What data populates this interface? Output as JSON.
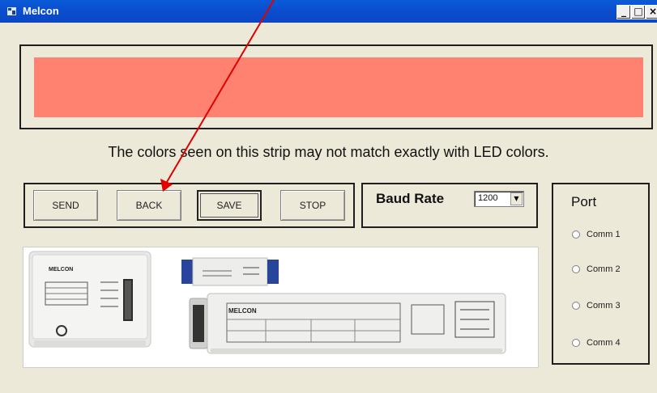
{
  "window": {
    "title": "Melcon",
    "minimize_glyph": "_",
    "maximize_glyph": "□",
    "close_glyph": "×"
  },
  "color_strip": {
    "color": "#ff8270"
  },
  "caption": "The colors seen on this strip may not match exactly with LED colors.",
  "buttons": {
    "send": "SEND",
    "back": "BACK",
    "save": "SAVE",
    "stop": "STOP"
  },
  "baud": {
    "label": "Baud Rate",
    "value": "1200",
    "arrow": "▼"
  },
  "port": {
    "title": "Port",
    "options": [
      "Comm 1",
      "Comm 2",
      "Comm 3",
      "Comm 4"
    ]
  },
  "product_image": {
    "brand": "MELCON",
    "brand_large": "MELCON",
    "colors": {
      "housing": "#e8e8e6",
      "label": "#f4f4f2",
      "connector_blue": "#27459a"
    }
  },
  "colors": {
    "annotation_arrow": "#e00000",
    "titlebar": "#0a4fd0",
    "window_bg": "#ece9d8"
  }
}
